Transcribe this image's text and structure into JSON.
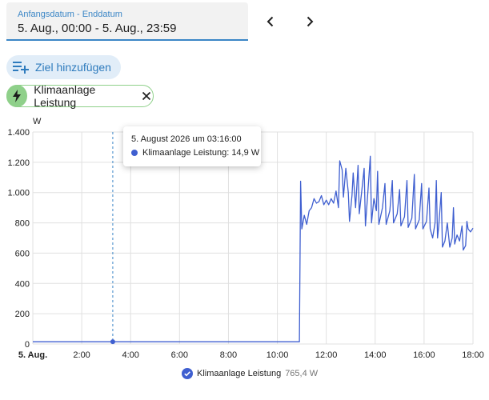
{
  "date_range": {
    "label": "Anfangsdatum - Enddatum",
    "value": "5. Aug., 00:00 - 5. Aug., 23:59"
  },
  "nav": {
    "prev_icon": "chevron-left-icon",
    "next_icon": "chevron-right-icon"
  },
  "add_target": {
    "label": "Ziel hinzufügen",
    "icon": "playlist-plus-icon"
  },
  "entity_chip": {
    "label": "Klimaanlage Leistung",
    "icon": "lightning-bolt-icon",
    "color": "#8fd08a"
  },
  "tooltip": {
    "title": "5. August 2026 um 03:16:00",
    "series": "Klimaanlage Leistung",
    "value": "14,9 W"
  },
  "legend": {
    "name": "Klimaanlage Leistung",
    "value": "765,4 W",
    "color": "#3f5fd0"
  },
  "chart_data": {
    "type": "line",
    "ylabel": "W",
    "ylim": [
      0,
      1400
    ],
    "y_ticks": [
      "0",
      "200",
      "400",
      "600",
      "800",
      "1.000",
      "1.200",
      "1.400"
    ],
    "y_tick_values": [
      0,
      200,
      400,
      600,
      800,
      1000,
      1200,
      1400
    ],
    "xlim": [
      0,
      18
    ],
    "x_ticks": [
      "5. Aug.",
      "2:00",
      "4:00",
      "6:00",
      "8:00",
      "10:00",
      "12:00",
      "14:00",
      "16:00",
      "18:00"
    ],
    "x_tick_values": [
      0,
      2,
      4,
      6,
      8,
      10,
      12,
      14,
      16,
      18
    ],
    "grid": true,
    "cursor_x": 3.27,
    "series": [
      {
        "name": "Klimaanlage Leistung",
        "color": "#3f5fd0",
        "points": [
          [
            0,
            15
          ],
          [
            3.27,
            14.9
          ],
          [
            10.9,
            15
          ],
          [
            10.95,
            1075
          ],
          [
            11.0,
            760
          ],
          [
            11.1,
            850
          ],
          [
            11.2,
            790
          ],
          [
            11.3,
            880
          ],
          [
            11.4,
            900
          ],
          [
            11.5,
            960
          ],
          [
            11.6,
            930
          ],
          [
            11.7,
            940
          ],
          [
            11.8,
            980
          ],
          [
            11.9,
            920
          ],
          [
            12.0,
            950
          ],
          [
            12.1,
            920
          ],
          [
            12.2,
            960
          ],
          [
            12.3,
            930
          ],
          [
            12.4,
            1010
          ],
          [
            12.5,
            900
          ],
          [
            12.55,
            1210
          ],
          [
            12.65,
            1150
          ],
          [
            12.7,
            970
          ],
          [
            12.8,
            1160
          ],
          [
            12.9,
            1000
          ],
          [
            12.95,
            810
          ],
          [
            13.05,
            980
          ],
          [
            13.1,
            1130
          ],
          [
            13.2,
            900
          ],
          [
            13.3,
            1180
          ],
          [
            13.35,
            860
          ],
          [
            13.45,
            1010
          ],
          [
            13.55,
            1160
          ],
          [
            13.6,
            780
          ],
          [
            13.7,
            1000
          ],
          [
            13.8,
            1240
          ],
          [
            13.85,
            800
          ],
          [
            13.95,
            960
          ],
          [
            14.05,
            880
          ],
          [
            14.1,
            1140
          ],
          [
            14.15,
            790
          ],
          [
            14.3,
            900
          ],
          [
            14.4,
            1060
          ],
          [
            14.45,
            790
          ],
          [
            14.6,
            880
          ],
          [
            14.7,
            1080
          ],
          [
            14.75,
            800
          ],
          [
            14.9,
            860
          ],
          [
            15.0,
            1020
          ],
          [
            15.05,
            780
          ],
          [
            15.2,
            840
          ],
          [
            15.3,
            1080
          ],
          [
            15.35,
            770
          ],
          [
            15.5,
            830
          ],
          [
            15.6,
            1120
          ],
          [
            15.65,
            760
          ],
          [
            15.8,
            820
          ],
          [
            15.9,
            1060
          ],
          [
            15.95,
            760
          ],
          [
            16.1,
            810
          ],
          [
            16.2,
            1030
          ],
          [
            16.25,
            760
          ],
          [
            16.35,
            700
          ],
          [
            16.45,
            800
          ],
          [
            16.5,
            1080
          ],
          [
            16.55,
            700
          ],
          [
            16.6,
            780
          ],
          [
            16.7,
            1000
          ],
          [
            16.75,
            640
          ],
          [
            16.85,
            680
          ],
          [
            16.95,
            800
          ],
          [
            17.05,
            640
          ],
          [
            17.15,
            700
          ],
          [
            17.2,
            900
          ],
          [
            17.25,
            660
          ],
          [
            17.35,
            720
          ],
          [
            17.45,
            680
          ],
          [
            17.55,
            780
          ],
          [
            17.6,
            620
          ],
          [
            17.7,
            650
          ],
          [
            17.75,
            810
          ],
          [
            17.8,
            760
          ],
          [
            17.9,
            740
          ],
          [
            18.0,
            765
          ]
        ]
      }
    ]
  }
}
